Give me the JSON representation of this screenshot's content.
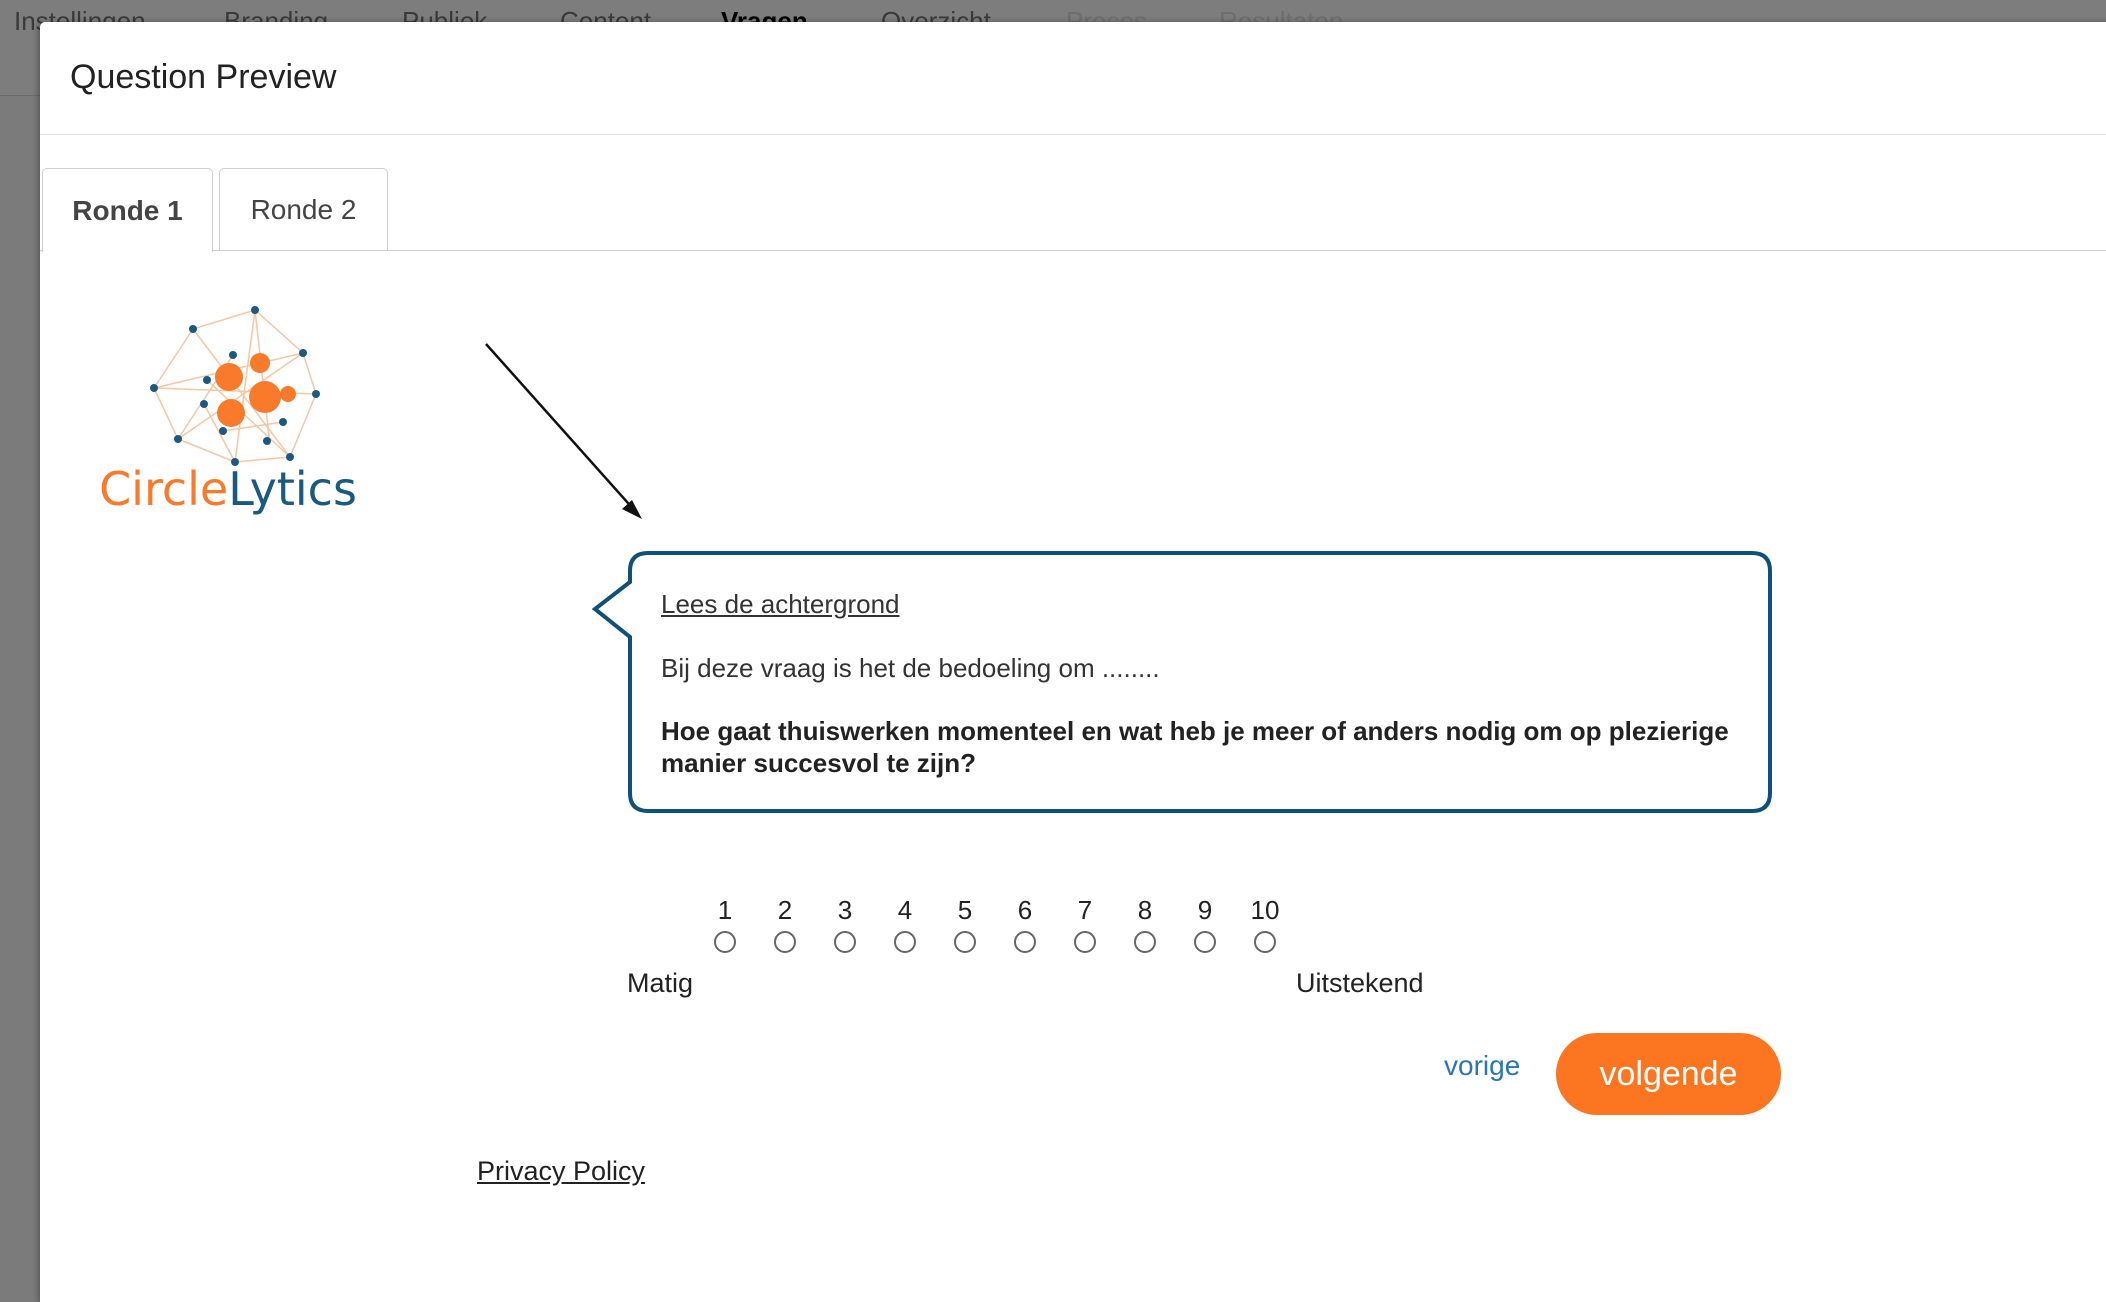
{
  "nav": {
    "items": [
      {
        "label": "Instellingen",
        "state": "normal"
      },
      {
        "label": "Branding",
        "state": "normal"
      },
      {
        "label": "Publiek",
        "state": "normal"
      },
      {
        "label": "Content",
        "state": "normal"
      },
      {
        "label": "Vragen",
        "state": "active"
      },
      {
        "label": "Overzicht",
        "state": "normal"
      },
      {
        "label": "Proces",
        "state": "disabled"
      },
      {
        "label": "Resultaten",
        "state": "disabled"
      }
    ]
  },
  "modal": {
    "title": "Question Preview",
    "tabs": [
      {
        "label": "Ronde 1",
        "active": true
      },
      {
        "label": "Ronde 2",
        "active": false
      }
    ]
  },
  "logo": {
    "text_part1": "Circle",
    "text_part2": "Lytics",
    "orange": "#f97a2b",
    "blue": "#1b5a80"
  },
  "question": {
    "background_link": "Lees de achtergrond",
    "intro": "Bij deze vraag is het de bedoeling om ........",
    "text": "Hoe gaat thuiswerken momenteel en wat heb je meer of anders nodig om op plezierige manier succesvol te zijn?",
    "border_color": "#0d5079"
  },
  "scale": {
    "options": [
      "1",
      "2",
      "3",
      "4",
      "5",
      "6",
      "7",
      "8",
      "9",
      "10"
    ],
    "selected": null,
    "min_label": "Matig",
    "max_label": "Uitstekend"
  },
  "navigation": {
    "previous_label": "vorige",
    "next_label": "volgende",
    "accent": "#fc7621",
    "link_color": "#2a74b8"
  },
  "footer": {
    "privacy_label": "Privacy Policy"
  }
}
